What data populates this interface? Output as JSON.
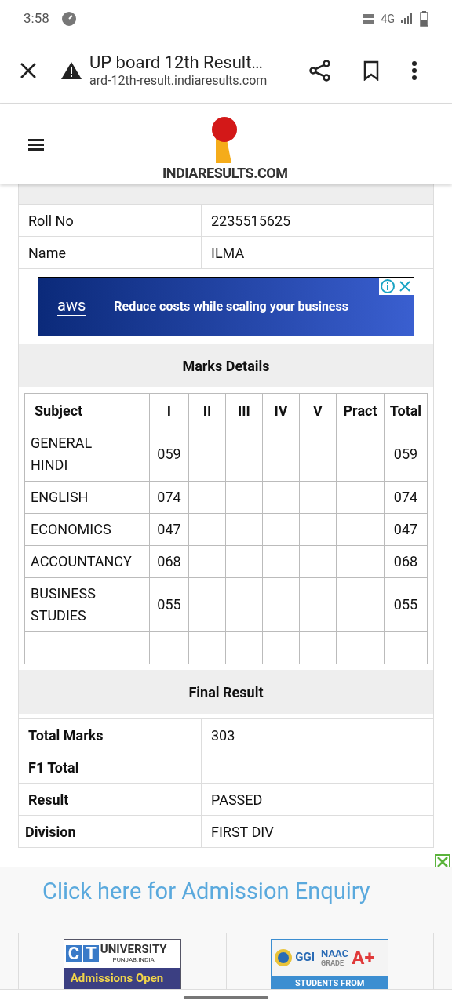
{
  "status_bar": {
    "time": "3:58",
    "network": "4G"
  },
  "browser": {
    "title": "UP board 12th Result…",
    "url": "ard-12th-result.indiaresults.com"
  },
  "site": {
    "logo": "INDIARESULTS.COM"
  },
  "student": [
    {
      "label": "Roll No",
      "value": "2235515625"
    },
    {
      "label": "Name",
      "value": "ILMA"
    }
  ],
  "ad": {
    "text": "Reduce costs while scaling your business",
    "brand": "aws"
  },
  "marks": {
    "title": "Marks Details",
    "columns": [
      "Subject",
      "I",
      "II",
      "III",
      "IV",
      "V",
      "Pract",
      "Total"
    ],
    "rows": [
      [
        "GENERAL HINDI",
        "059",
        "",
        "",
        "",
        "",
        "",
        "059"
      ],
      [
        "ENGLISH",
        "074",
        "",
        "",
        "",
        "",
        "",
        "074"
      ],
      [
        "ECONOMICS",
        "047",
        "",
        "",
        "",
        "",
        "",
        "047"
      ],
      [
        "ACCOUNTANCY",
        "068",
        "",
        "",
        "",
        "",
        "",
        "068"
      ],
      [
        "BUSINESS STUDIES",
        "055",
        "",
        "",
        "",
        "",
        "",
        "055"
      ],
      [
        "",
        "",
        "",
        "",
        "",
        "",
        "",
        ""
      ]
    ]
  },
  "final": {
    "title": "Final Result",
    "rows": [
      {
        "label": "Total Marks",
        "value": "303"
      },
      {
        "label": "F1 Total",
        "value": ""
      },
      {
        "label": "Result",
        "value": "PASSED"
      },
      {
        "label": "Division",
        "value": "FIRST DIV"
      }
    ]
  },
  "admission": {
    "link": "Click here for Admission Enquiry",
    "banners": [
      {
        "kind": "ct",
        "lines": [
          "C",
          "T",
          "UNIVERSITY",
          "PUNJAB.INDIA",
          "Admissions Open"
        ]
      },
      {
        "kind": "ggi",
        "lines": [
          "GGI",
          "NAAC",
          "GRADE",
          "A+",
          "STUDENTS FROM"
        ]
      }
    ]
  }
}
